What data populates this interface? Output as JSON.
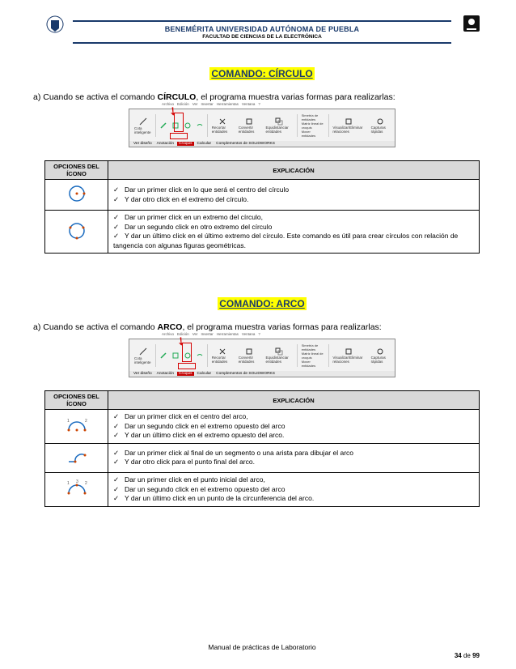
{
  "header": {
    "title": "BENEMÉRITA UNIVERSIDAD AUTÓNOMA DE PUEBLA",
    "subtitle": "FACULTAD DE CIENCIAS DE LA ELECTRÓNICA"
  },
  "menubar": [
    "Archivo",
    "Edición",
    "Ver",
    "Insertar",
    "Herramientas",
    "Ventana",
    "?"
  ],
  "ribbon": {
    "items": [
      "Cota inteligente",
      "",
      "",
      "",
      "Recortar entidades",
      "Convertir entidades",
      "Equidistanciar entidades",
      "",
      "Simetría de entidades",
      "Matriz lineal de croquis",
      "Mover entidades",
      "",
      "Visualizar/Eliminar relaciones",
      "Capturas rápidas"
    ],
    "tabs": [
      "Ver diseño",
      "Anotación",
      "Croquis",
      "Calcular",
      "Complementos de SOLIDWORKS"
    ]
  },
  "section1": {
    "title": "COMANDO: CÍRCULO",
    "intro_pre": "a)  Cuando se activa el comando ",
    "intro_bold": "CÍRCULO",
    "intro_post": ", el programa muestra varias formas para realizarlas:",
    "table": {
      "h1": "OPCIONES DEL ÍCONO",
      "h2": "EXPLICACIÓN",
      "rows": [
        {
          "lines": [
            "Dar un primer click en lo que será el centro del círculo",
            "Y dar otro click en el extremo del círculo."
          ]
        },
        {
          "lines": [
            "Dar un primer click en un extremo del círculo,",
            "Dar un segundo click en otro extremo del círculo",
            "Y dar un último click en el último extremo del círculo. Este comando es útil para crear círculos con relación de tangencia con algunas figuras geométricas."
          ]
        }
      ]
    }
  },
  "section2": {
    "title": "COMANDO: ARCO",
    "intro_pre": "a)  Cuando se activa el comando ",
    "intro_bold": "ARCO",
    "intro_post": ", el programa muestra varias formas para realizarlas:",
    "table": {
      "h1": "OPCIONES DEL ÍCONO",
      "h2": "EXPLICACIÓN",
      "rows": [
        {
          "lines": [
            "Dar un primer click en el centro del arco,",
            "Dar un segundo click en el extremo opuesto del arco",
            "Y dar un último click en el extremo opuesto del arco."
          ]
        },
        {
          "lines": [
            "Dar un primer click al final de un segmento o una arista para dibujar el arco",
            "Y dar otro click para el punto final del arco."
          ]
        },
        {
          "lines": [
            "Dar un primer click en el punto inicial del arco,",
            "Dar un segundo click en el extremo opuesto del arco",
            "Y dar un último click en un punto de la circunferencia del arco."
          ]
        }
      ]
    }
  },
  "footer": {
    "text": "Manual de prácticas de Laboratorio",
    "page": "34",
    "total": "99",
    "de": " de "
  }
}
